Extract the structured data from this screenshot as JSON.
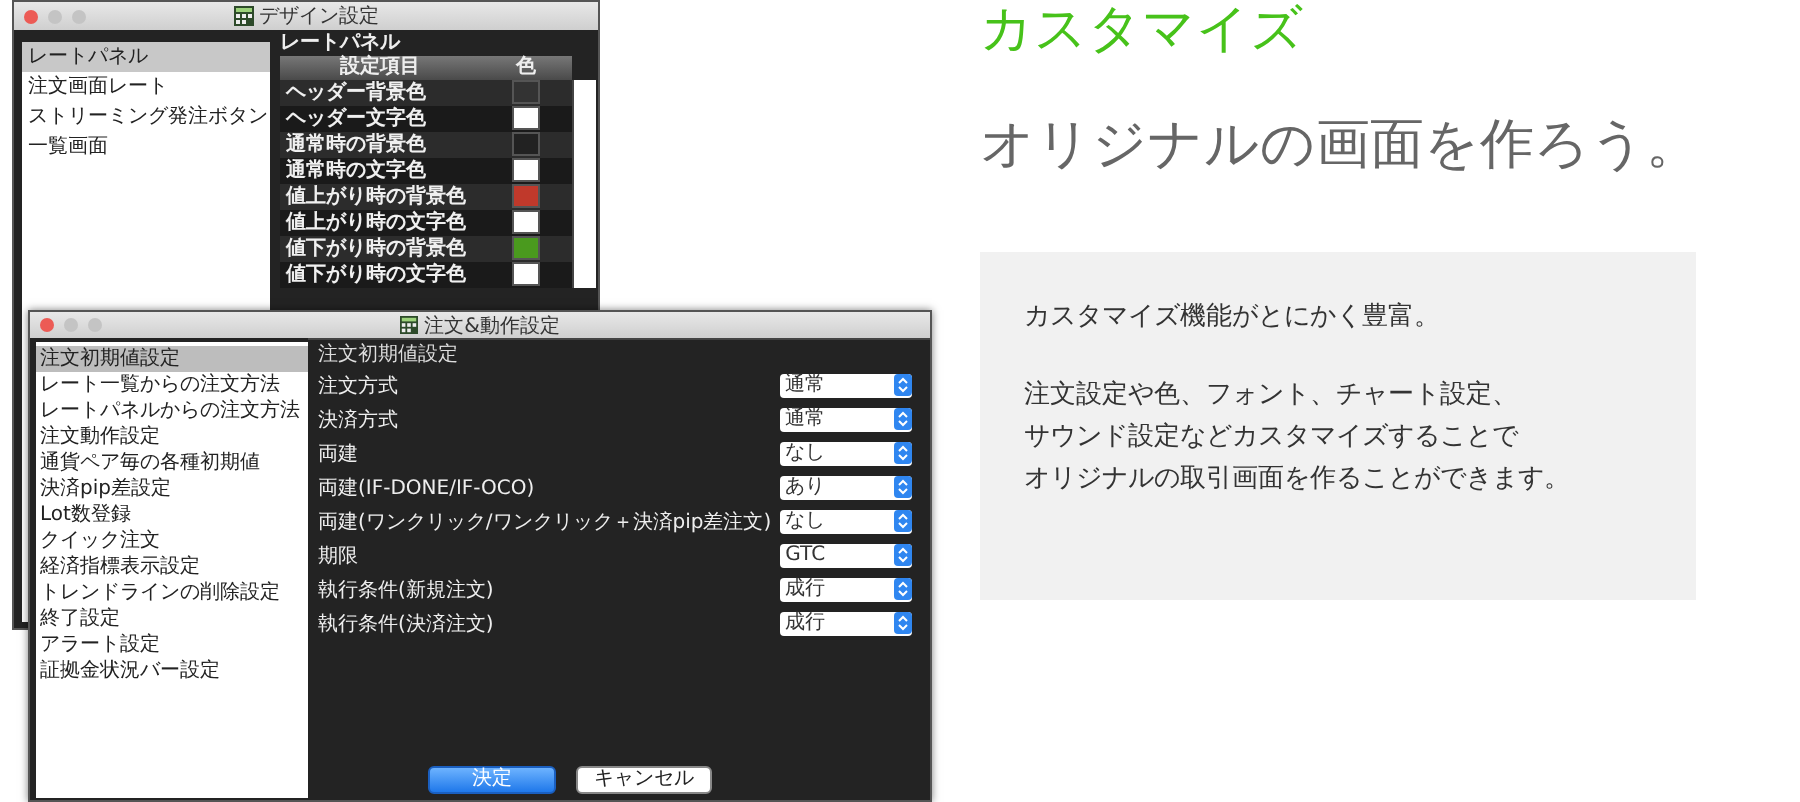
{
  "design_window": {
    "title": "デザイン設定",
    "sidebar": [
      {
        "label": "レートパネル",
        "selected": true
      },
      {
        "label": "注文画面レート",
        "selected": false
      },
      {
        "label": "ストリーミング発注ボタン",
        "selected": false
      },
      {
        "label": "一覧画面",
        "selected": false
      }
    ],
    "panel_title": "レートパネル",
    "columns": [
      "設定項目",
      "色"
    ],
    "rows": [
      {
        "name": "ヘッダー背景色",
        "color": "#333333"
      },
      {
        "name": "ヘッダー文字色",
        "color": "#ffffff"
      },
      {
        "name": "通常時の背景色",
        "color": "#222222"
      },
      {
        "name": "通常時の文字色",
        "color": "#ffffff"
      },
      {
        "name": "値上がり時の背景色",
        "color": "#c0392b"
      },
      {
        "name": "値上がり時の文字色",
        "color": "#ffffff"
      },
      {
        "name": "値下がり時の背景色",
        "color": "#4a9a1e"
      },
      {
        "name": "値下がり時の文字色",
        "color": "#ffffff"
      }
    ]
  },
  "order_window": {
    "title": "注文&動作設定",
    "sidebar": [
      {
        "label": "注文初期値設定",
        "selected": true
      },
      {
        "label": "レート一覧からの注文方法",
        "selected": false
      },
      {
        "label": "レートパネルからの注文方法",
        "selected": false
      },
      {
        "label": "注文動作設定",
        "selected": false
      },
      {
        "label": "通貨ペア毎の各種初期値",
        "selected": false
      },
      {
        "label": "決済pip差設定",
        "selected": false
      },
      {
        "label": "Lot数登録",
        "selected": false
      },
      {
        "label": "クイック注文",
        "selected": false
      },
      {
        "label": "経済指標表示設定",
        "selected": false
      },
      {
        "label": "トレンドラインの削除設定",
        "selected": false
      },
      {
        "label": "終了設定",
        "selected": false
      },
      {
        "label": "アラート設定",
        "selected": false
      },
      {
        "label": "証拠金状況バー設定",
        "selected": false
      }
    ],
    "section_title": "注文初期値設定",
    "settings": [
      {
        "label": "注文方式",
        "value": "通常"
      },
      {
        "label": "決済方式",
        "value": "通常"
      },
      {
        "label": "両建",
        "value": "なし"
      },
      {
        "label": "両建(IF-DONE/IF-OCO)",
        "value": "あり"
      },
      {
        "label": "両建(ワンクリック/ワンクリック＋決済pip差注文)",
        "value": "なし"
      },
      {
        "label": "期限",
        "value": "GTC"
      },
      {
        "label": "執行条件(新規注文)",
        "value": "成行"
      },
      {
        "label": "執行条件(決済注文)",
        "value": "成行"
      }
    ],
    "buttons": [
      {
        "label": "決定",
        "kind": "primary"
      },
      {
        "label": "キャンセル",
        "kind": "secondary"
      }
    ]
  },
  "promo": {
    "heading": "カスタマイズ",
    "subheading": "オリジナルの画面を作ろう。",
    "paragraphs": [
      [
        "カスタマイズ機能がとにかく豊富。"
      ],
      [
        "注文設定や色、フォント、チャート設定、",
        "サウンド設定などカスタマイズすることで",
        "オリジナルの取引画面を作ることができます。"
      ]
    ]
  }
}
